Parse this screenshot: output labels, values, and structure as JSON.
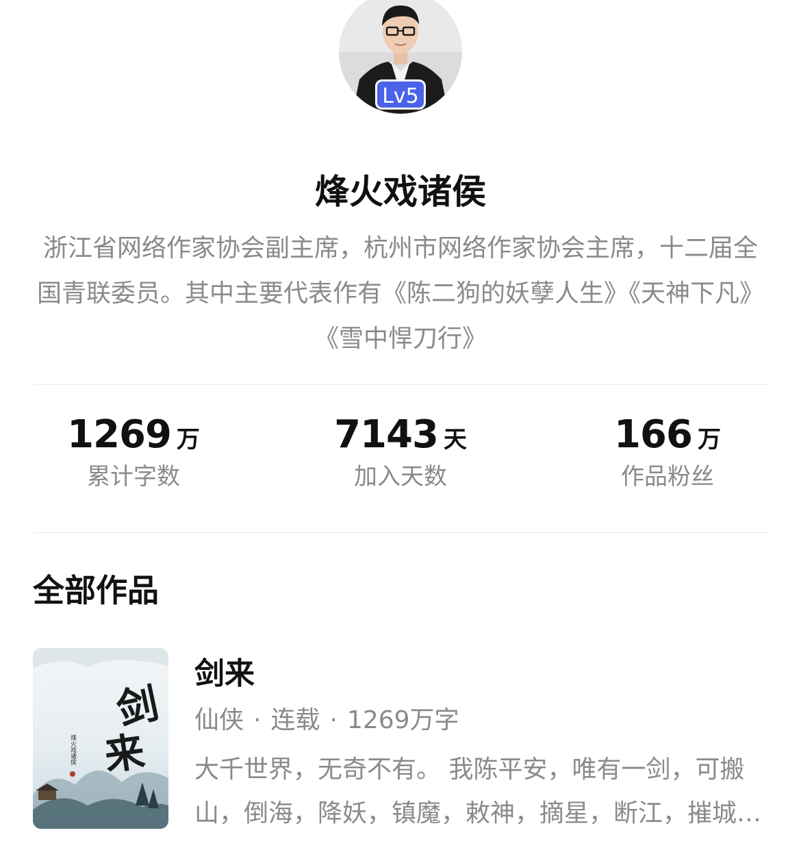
{
  "author": {
    "level_badge": "Lv5",
    "name": "烽火戏诸侯",
    "bio": "浙江省网络作家协会副主席，杭州市网络作家协会主席，十二届全国青联委员。其中主要代表作有《陈二狗的妖孽人生》《天神下凡》《雪中悍刀行》"
  },
  "stats": [
    {
      "number": "1269",
      "unit": "万",
      "label": "累计字数"
    },
    {
      "number": "7143",
      "unit": "天",
      "label": "加入天数"
    },
    {
      "number": "166",
      "unit": "万",
      "label": "作品粉丝"
    }
  ],
  "works_section": {
    "title": "全部作品"
  },
  "books": [
    {
      "title": "剑来",
      "genre": "仙侠",
      "status": "连载",
      "word_count": "1269万字",
      "separator": "·",
      "description": "大千世界，无奇不有。 我陈平安，唯有一剑，可搬山，倒海，降妖，镇魔，敕神，摘星，断江，摧城，开天！",
      "cover_title_text": "剑来",
      "cover_author_text": "烽火戏诸侯"
    }
  ],
  "colors": {
    "accent_badge": "#4a63e8",
    "text_primary": "#111111",
    "text_secondary": "#8a8a8a",
    "divider": "#ececec"
  },
  "icons": {
    "avatar": "author-photo",
    "cover": "book-cover-illustration"
  }
}
